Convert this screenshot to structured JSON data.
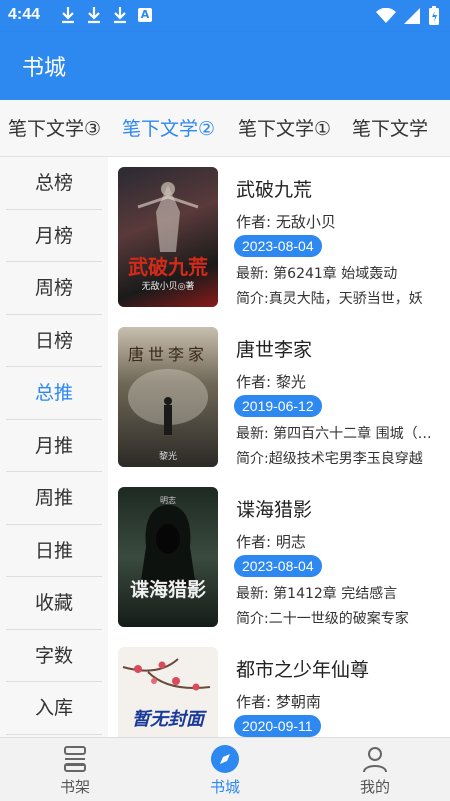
{
  "status": {
    "time": "4:44",
    "a_badge": "A"
  },
  "app": {
    "title": "书城"
  },
  "tabs": [
    {
      "label": "笔下文学③"
    },
    {
      "label": "笔下文学②",
      "active": true
    },
    {
      "label": "笔下文学①"
    },
    {
      "label": "笔下文学"
    }
  ],
  "sidebar": {
    "items": [
      {
        "label": "总榜"
      },
      {
        "label": "月榜"
      },
      {
        "label": "周榜"
      },
      {
        "label": "日榜"
      },
      {
        "label": "总推",
        "active": true
      },
      {
        "label": "月推"
      },
      {
        "label": "周推"
      },
      {
        "label": "日推"
      },
      {
        "label": "收藏"
      },
      {
        "label": "字数"
      },
      {
        "label": "入库"
      }
    ]
  },
  "books": [
    {
      "title": "武破九荒",
      "author": "作者: 无敌小贝",
      "date": "2023-08-04",
      "latest": "最新: 第6241章 始域轰动",
      "intro": "简介:真灵大陆，天骄当世，妖",
      "cover_text": "武破九荒",
      "cover_sub": "无敌小贝◎著"
    },
    {
      "title": "唐世李家",
      "author": "作者: 黎光",
      "date": "2019-06-12",
      "latest": "最新: 第四百六十二章 围城（…",
      "intro": "简介:超级技术宅男李玉良穿越",
      "cover_text": "唐世李家",
      "cover_sub": "黎光"
    },
    {
      "title": "谍海猎影",
      "author": "作者: 明志",
      "date": "2023-08-04",
      "latest": "最新: 第1412章 完结感言",
      "intro": "简介:二十一世级的破案专家",
      "cover_text": "谍海猎影",
      "cover_sub": "明志"
    },
    {
      "title": "都市之少年仙尊",
      "author": "作者: 梦朝南",
      "date": "2020-09-11",
      "latest": "",
      "intro": "",
      "cover_text": "暂无封面",
      "cover_sub": ""
    }
  ],
  "nav": {
    "items": [
      {
        "label": "书架",
        "icon": "bookshelf-icon"
      },
      {
        "label": "书城",
        "icon": "compass-icon",
        "active": true
      },
      {
        "label": "我的",
        "icon": "person-icon"
      }
    ]
  },
  "colors": {
    "accent": "#2d88f0",
    "tab_bg": "#f7f7f7"
  }
}
